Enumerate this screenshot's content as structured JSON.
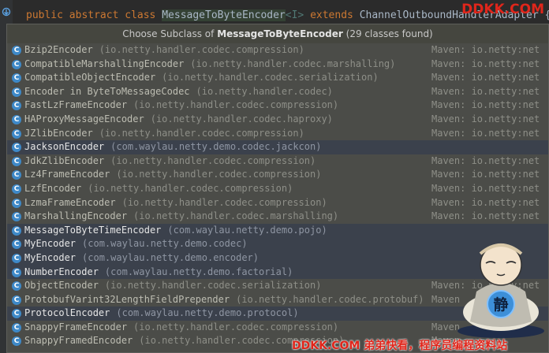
{
  "editor": {
    "line_parts": {
      "kw1": "public",
      "kw2": "abstract",
      "kw3": "class",
      "classname": "MessageToByteEncoder",
      "typeparam": "<I>",
      "kw4": "extends",
      "superclass": "ChannelOutboundHandlerAdapter",
      "brace": "{"
    }
  },
  "popup": {
    "title_prefix": "Choose Subclass of",
    "title_class": "MessageToByteEncoder",
    "title_count": "(29 classes found)",
    "rows": [
      {
        "name": "Bzip2Encoder",
        "pkg": "(io.netty.handler.codec.compression)",
        "src": "Maven: io.netty:net",
        "kind": "library"
      },
      {
        "name": "CompatibleMarshallingEncoder",
        "pkg": "(io.netty.handler.codec.marshalling)",
        "src": "Maven: io.netty:net",
        "kind": "library"
      },
      {
        "name": "CompatibleObjectEncoder",
        "pkg": "(io.netty.handler.codec.serialization)",
        "src": "Maven: io.netty:net",
        "kind": "library"
      },
      {
        "name": "Encoder in ByteToMessageCodec",
        "pkg": "(io.netty.handler.codec)",
        "src": "Maven: io.netty:net",
        "kind": "library"
      },
      {
        "name": "FastLzFrameEncoder",
        "pkg": "(io.netty.handler.codec.compression)",
        "src": "Maven: io.netty:net",
        "kind": "library"
      },
      {
        "name": "HAProxyMessageEncoder",
        "pkg": "(io.netty.handler.codec.haproxy)",
        "src": "Maven: io.netty:net",
        "kind": "library"
      },
      {
        "name": "JZlibEncoder",
        "pkg": "(io.netty.handler.codec.compression)",
        "src": "Maven: io.netty:net",
        "kind": "library"
      },
      {
        "name": "JacksonEncoder",
        "pkg": "(com.waylau.netty.demo.codec.jackcon)",
        "src": "",
        "kind": "project"
      },
      {
        "name": "JdkZlibEncoder",
        "pkg": "(io.netty.handler.codec.compression)",
        "src": "Maven: io.netty:net",
        "kind": "library"
      },
      {
        "name": "Lz4FrameEncoder",
        "pkg": "(io.netty.handler.codec.compression)",
        "src": "Maven: io.netty:net",
        "kind": "library"
      },
      {
        "name": "LzfEncoder",
        "pkg": "(io.netty.handler.codec.compression)",
        "src": "Maven: io.netty:net",
        "kind": "library"
      },
      {
        "name": "LzmaFrameEncoder",
        "pkg": "(io.netty.handler.codec.compression)",
        "src": "Maven: io.netty:net",
        "kind": "library"
      },
      {
        "name": "MarshallingEncoder",
        "pkg": "(io.netty.handler.codec.marshalling)",
        "src": "Maven: io.netty:net",
        "kind": "library"
      },
      {
        "name": "MessageToByteTimeEncoder",
        "pkg": "(com.waylau.netty.demo.pojo)",
        "src": "",
        "kind": "project"
      },
      {
        "name": "MyEncoder",
        "pkg": "(com.waylau.netty.demo.codec)",
        "src": "",
        "kind": "project"
      },
      {
        "name": "MyEncoder",
        "pkg": "(com.waylau.netty.demo.encoder)",
        "src": "",
        "kind": "project"
      },
      {
        "name": "NumberEncoder",
        "pkg": "(com.waylau.netty.demo.factorial)",
        "src": "",
        "kind": "project"
      },
      {
        "name": "ObjectEncoder",
        "pkg": "(io.netty.handler.codec.serialization)",
        "src": "Maven: io.netty:net",
        "kind": "library"
      },
      {
        "name": "ProtobufVarint32LengthFieldPrepender",
        "pkg": "(io.netty.handler.codec.protobuf)",
        "src": "Maven",
        "kind": "library"
      },
      {
        "name": "ProtocolEncoder",
        "pkg": "(com.waylau.netty.demo.protocol)",
        "src": "",
        "kind": "project"
      },
      {
        "name": "SnappyFrameEncoder",
        "pkg": "(io.netty.handler.codec.compression)",
        "src": "Maven",
        "kind": "library"
      },
      {
        "name": "SnappyFramedEncoder",
        "pkg": "(io.netty.handler.codec.compression)",
        "src": "Maven",
        "kind": "library"
      }
    ]
  },
  "watermarks": {
    "top": "DDKK.COM",
    "bottom": "DDKK.COM 弟弟快看，程序员编程资料站",
    "mascot_glyph": "静"
  },
  "icons": {
    "class_icon": "C",
    "gutter_icon": "implemented-gutter-icon"
  },
  "colors": {
    "popup_bg": "#4b4c48",
    "project_row_bg": "#3b414c",
    "class_icon": "#3e89c8",
    "keyword": "#cc7832",
    "watermark": "#e0261b"
  }
}
